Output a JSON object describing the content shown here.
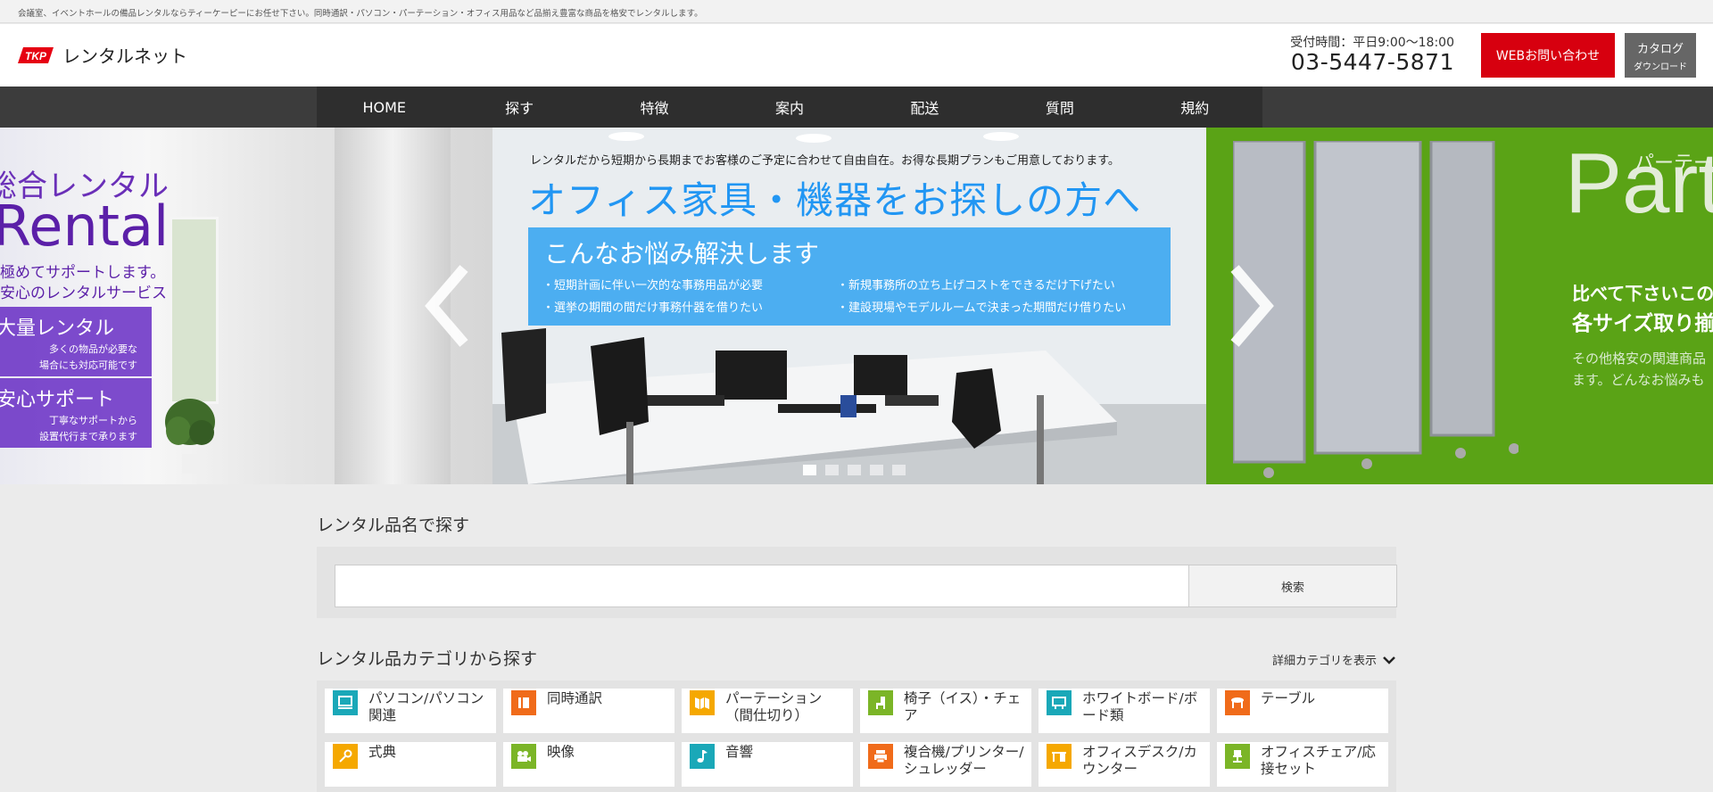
{
  "topbar": {
    "text": "会議室、イベントホールの備品レンタルならティーケーピーにお任せ下さい。同時通訳・パソコン・パーテーション・オフィス用品など品揃え豊富な商品を格安でレンタルします。"
  },
  "header": {
    "logo_mark": "TKP",
    "logo_text": "レンタルネット",
    "hours": "受付時間：平日9:00〜18:00",
    "phone": "03-5447-5871",
    "contact_button": "WEBお問い合わせ",
    "catalog_button_line1": "カタログ",
    "catalog_button_line2": "ダウンロード"
  },
  "nav": {
    "items": [
      {
        "label": "HOME"
      },
      {
        "label": "探す"
      },
      {
        "label": "特徴"
      },
      {
        "label": "案内"
      },
      {
        "label": "配送"
      },
      {
        "label": "質問"
      },
      {
        "label": "規約"
      }
    ]
  },
  "slider": {
    "left": {
      "title": "総合レンタル",
      "big": "Rental",
      "sub1": "極めてサポートします。",
      "sub2": "安心のレンタルサービス",
      "box1_heading": "大量レンタル",
      "box1_line1": "多くの物品が必要な",
      "box1_line2": "場合にも対応可能です",
      "box2_heading": "安心サポート",
      "box2_line1": "丁寧なサポートから",
      "box2_line2": "設置代行まで承ります"
    },
    "main": {
      "lead": "レンタルだから短期から長期までお客様のご予定に合わせて自由自在。お得な長期プランもご用意しております。",
      "title": "オフィス家具・機器をお探しの方へ",
      "box_heading": "こんなお悩み解決します",
      "points": [
        "・短期計画に伴い一次的な事務用品が必要",
        "・選挙の期間の間だけ事務什器を借りたい",
        "・新規事務所の立ち上げコストをできるだけ下げたい",
        "・建設現場やモデルルームで決まった期間だけ借りたい"
      ]
    },
    "right": {
      "title_small": "パーテー",
      "title_big": "Part",
      "line1": "比べて下さいこの",
      "line2": "各サイズ取り揃",
      "line3": "その他格安の関連商品",
      "line4": "ます。どんなお悩みも"
    },
    "prev_icon": "chevron-left-icon",
    "next_icon": "chevron-right-icon",
    "dot_count": 5,
    "active_dot": 1
  },
  "search": {
    "title": "レンタル品名で探す",
    "input_value": "",
    "placeholder": "",
    "button": "検索"
  },
  "categories": {
    "title": "レンタル品カテゴリから探す",
    "detail_toggle": "詳細カテゴリを表示",
    "items": [
      {
        "label": "パソコン/パソコン関連",
        "icon": "computer-icon",
        "color": "#1aa8b8"
      },
      {
        "label": "同時通訳",
        "icon": "book-icon",
        "color": "#f06b1a"
      },
      {
        "label": "パーテーション（間仕切り）",
        "icon": "partition-icon",
        "color": "#f5a800"
      },
      {
        "label": "椅子（イス）・チェア",
        "icon": "chair-icon",
        "color": "#7bb527"
      },
      {
        "label": "ホワイトボード/ボード類",
        "icon": "whiteboard-icon",
        "color": "#1aa8b8"
      },
      {
        "label": "テーブル",
        "icon": "table-icon",
        "color": "#f06b1a"
      },
      {
        "label": "式典",
        "icon": "key-icon",
        "color": "#f5a800"
      },
      {
        "label": "映像",
        "icon": "video-camera-icon",
        "color": "#7bb527"
      },
      {
        "label": "音響",
        "icon": "music-note-icon",
        "color": "#1aa8b8"
      },
      {
        "label": "複合機/プリンター/シュレッダー",
        "icon": "printer-icon",
        "color": "#f06b1a"
      },
      {
        "label": "オフィスデスク/カウンター",
        "icon": "desk-icon",
        "color": "#f5a800"
      },
      {
        "label": "オフィスチェア/応接セット",
        "icon": "office-chair-icon",
        "color": "#7bb527"
      }
    ]
  },
  "colors": {
    "accent_red": "#d7000f",
    "nav_bg": "#2e2e2e",
    "slide_blue": "#2196f3",
    "slide_green": "#5aa316",
    "slide_purple": "#5b1fa8"
  }
}
